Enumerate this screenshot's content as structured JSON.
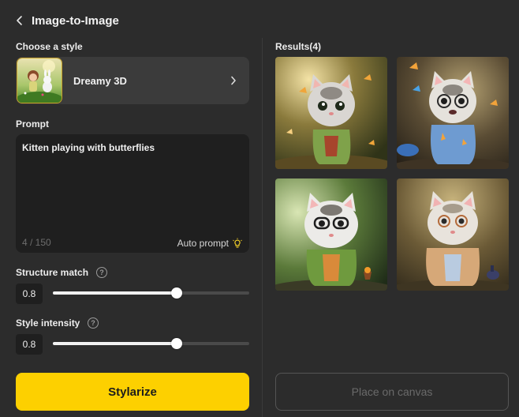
{
  "header": {
    "title": "Image-to-Image",
    "back_icon": "chevron-left-icon"
  },
  "style": {
    "section_label": "Choose a style",
    "selected_name": "Dreamy 3D",
    "chevron_icon": "chevron-right-icon"
  },
  "prompt": {
    "section_label": "Prompt",
    "value": "Kitten playing with butterflies",
    "counter": "4 / 150",
    "auto_prompt_label": "Auto prompt",
    "auto_prompt_icon": "lightbulb-icon"
  },
  "structure_match": {
    "label": "Structure match",
    "value": "0.8",
    "fraction": 0.8,
    "help_glyph": "?"
  },
  "style_intensity": {
    "label": "Style intensity",
    "value": "0.8",
    "fraction": 0.8,
    "help_glyph": "?"
  },
  "actions": {
    "stylarize_label": "Stylarize",
    "place_on_canvas_label": "Place on canvas"
  },
  "results": {
    "label": "Results(4)",
    "items": [
      {
        "description": "kitten-green-jacket-butterflies"
      },
      {
        "description": "kitten-blue-jacket-glasses"
      },
      {
        "description": "kitten-green-jacket-glasses"
      },
      {
        "description": "kitten-tan-jacket-glasses"
      }
    ]
  },
  "colors": {
    "background": "#2c2c2c",
    "primary_button": "#fdd000",
    "style_thumb_border": "#c9a227",
    "slider_fill": "#f2f2f2"
  }
}
